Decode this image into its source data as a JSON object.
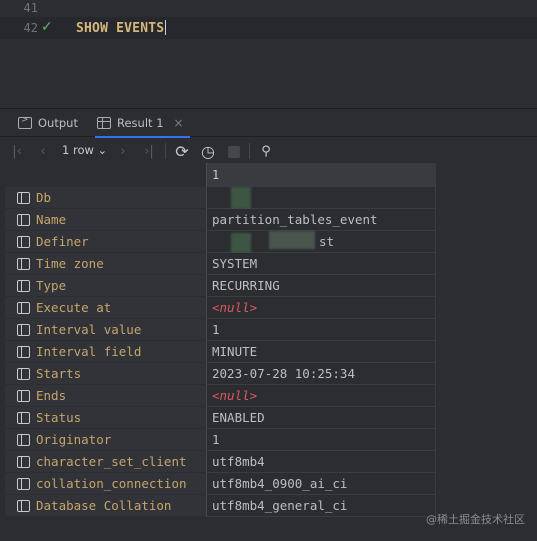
{
  "editor": {
    "lines": [
      {
        "number": "41",
        "code": ""
      },
      {
        "number": "42",
        "code": "SHOW EVENTS"
      }
    ]
  },
  "tabs": {
    "output_label": "Output",
    "result_label": "Result 1",
    "close_glyph": "×"
  },
  "toolbar": {
    "rows_label": "1 row",
    "chevron": "⌄",
    "first_glyph": "|‹",
    "prev_glyph": "‹",
    "next_glyph": "›",
    "last_glyph": "›|",
    "refresh_glyph": "⟳",
    "clock_glyph": "◷",
    "pin_glyph": "⚲"
  },
  "grid": {
    "column_header": "1",
    "rows": [
      {
        "label": "Db",
        "value": ""
      },
      {
        "label": "Name",
        "value": "partition_tables_event"
      },
      {
        "label": "Definer",
        "value": "st"
      },
      {
        "label": "Time zone",
        "value": "SYSTEM"
      },
      {
        "label": "Type",
        "value": "RECURRING"
      },
      {
        "label": "Execute at",
        "value": "<null>",
        "null": true
      },
      {
        "label": "Interval value",
        "value": "1"
      },
      {
        "label": "Interval field",
        "value": "MINUTE"
      },
      {
        "label": "Starts",
        "value": "2023-07-28 10:25:34"
      },
      {
        "label": "Ends",
        "value": "<null>",
        "null": true
      },
      {
        "label": "Status",
        "value": "ENABLED"
      },
      {
        "label": "Originator",
        "value": "1"
      },
      {
        "label": "character_set_client",
        "value": "utf8mb4"
      },
      {
        "label": "collation_connection",
        "value": "utf8mb4_0900_ai_ci"
      },
      {
        "label": "Database Collation",
        "value": "utf8mb4_general_ci"
      }
    ]
  },
  "watermark": "@稀土掘金技术社区",
  "colors": {
    "keyword": "#d5b778",
    "label": "#c6a56a",
    "null": "#e0575c",
    "check": "#5fb865",
    "accent": "#3574f0"
  }
}
